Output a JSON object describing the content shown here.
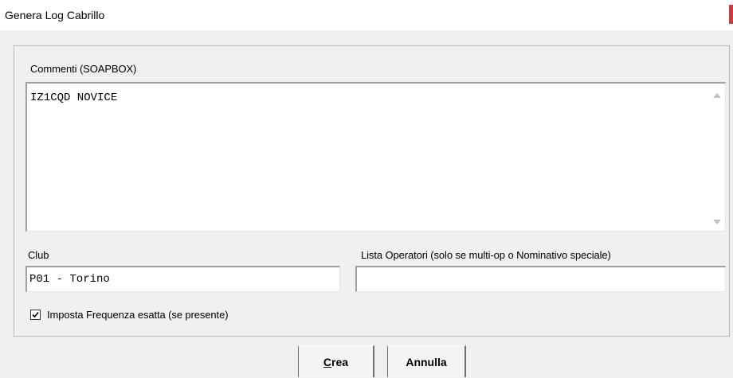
{
  "window": {
    "title": "Genera Log Cabrillo",
    "accent_color": "#d23a3a"
  },
  "soapbox": {
    "label": "Commenti (SOAPBOX)",
    "value": "IZ1CQD NOVICE",
    "scrollbar_up_icon": "scroll-up-arrow",
    "scrollbar_down_icon": "scroll-down-arrow"
  },
  "club": {
    "label": "Club",
    "value": "P01 - Torino"
  },
  "operators": {
    "label": "Lista Operatori (solo se multi-op o Nominativo speciale)",
    "value": ""
  },
  "options": {
    "exact_frequency_label": "Imposta Frequenza esatta (se presente)",
    "exact_frequency_checked": true
  },
  "buttons": {
    "create_label": "Crea",
    "cancel_label": "Annulla"
  }
}
